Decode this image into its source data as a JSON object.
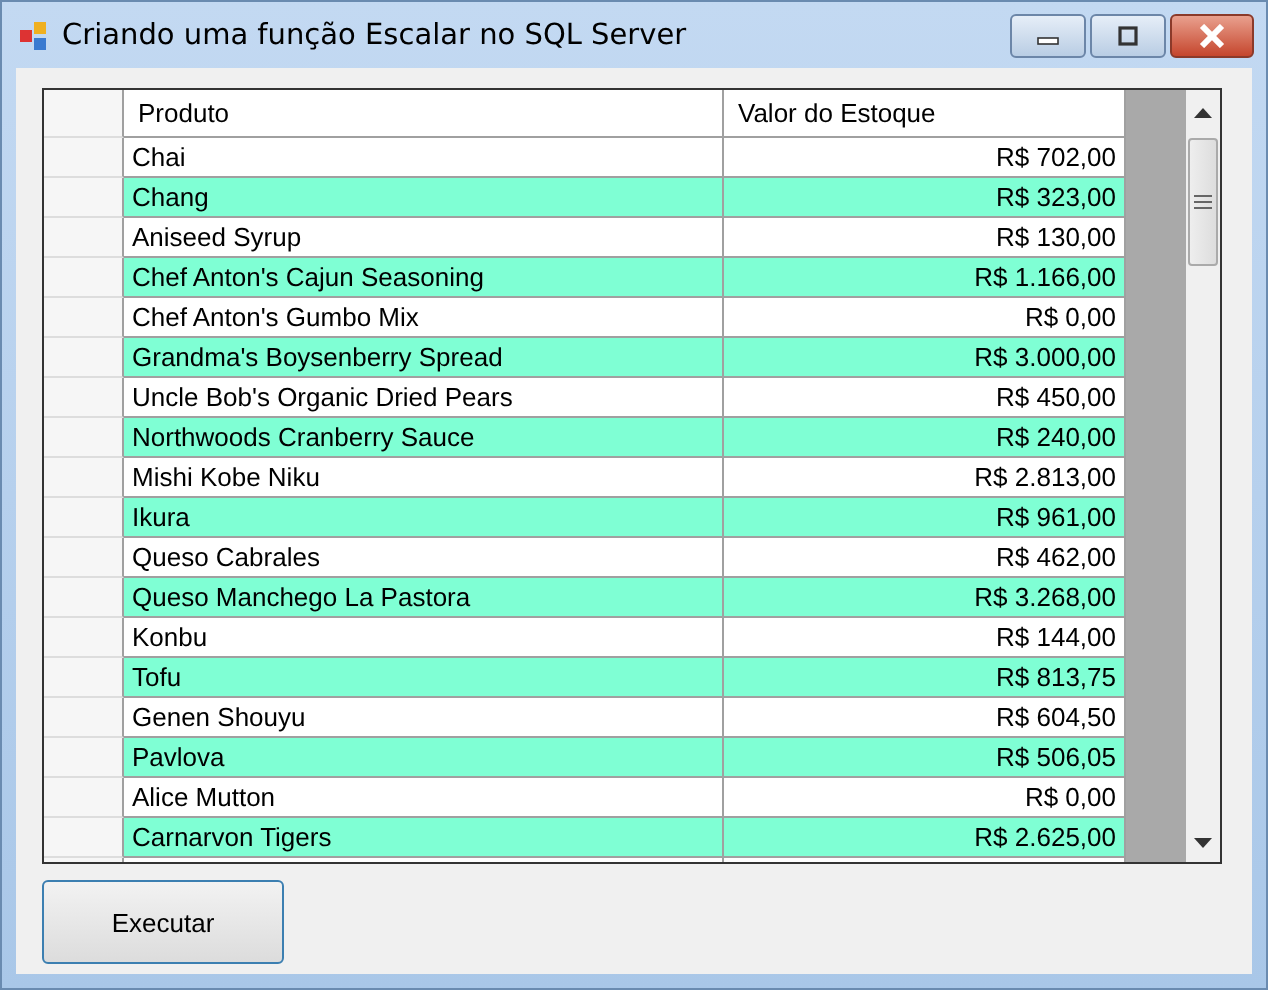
{
  "window": {
    "title": "Criando uma função Escalar no SQL Server"
  },
  "table": {
    "columns": [
      "Produto",
      "Valor do Estoque"
    ],
    "rows": [
      {
        "cells": [
          "Chai",
          "R$ 702,00"
        ],
        "color": "#ffffff"
      },
      {
        "cells": [
          "Chang",
          "R$ 323,00"
        ],
        "color": "#7fffd4"
      },
      {
        "cells": [
          "Aniseed Syrup",
          "R$ 130,00"
        ],
        "color": "#ffffff"
      },
      {
        "cells": [
          "Chef Anton's Cajun Seasoning",
          "R$ 1.166,00"
        ],
        "color": "#7fffd4"
      },
      {
        "cells": [
          "Chef Anton's Gumbo Mix",
          "R$ 0,00"
        ],
        "color": "#ffffff"
      },
      {
        "cells": [
          "Grandma's Boysenberry Spread",
          "R$ 3.000,00"
        ],
        "color": "#7fffd4"
      },
      {
        "cells": [
          "Uncle Bob's Organic Dried Pears",
          "R$ 450,00"
        ],
        "color": "#ffffff"
      },
      {
        "cells": [
          "Northwoods Cranberry Sauce",
          "R$ 240,00"
        ],
        "color": "#7fffd4"
      },
      {
        "cells": [
          "Mishi Kobe Niku",
          "R$ 2.813,00"
        ],
        "color": "#ffffff"
      },
      {
        "cells": [
          "Ikura",
          "R$ 961,00"
        ],
        "color": "#7fffd4"
      },
      {
        "cells": [
          "Queso Cabrales",
          "R$ 462,00"
        ],
        "color": "#ffffff"
      },
      {
        "cells": [
          "Queso Manchego La Pastora",
          "R$ 3.268,00"
        ],
        "color": "#7fffd4"
      },
      {
        "cells": [
          "Konbu",
          "R$ 144,00"
        ],
        "color": "#ffffff"
      },
      {
        "cells": [
          "Tofu",
          "R$ 813,75"
        ],
        "color": "#7fffd4"
      },
      {
        "cells": [
          "Genen Shouyu",
          "R$ 604,50"
        ],
        "color": "#ffffff"
      },
      {
        "cells": [
          "Pavlova",
          "R$ 506,05"
        ],
        "color": "#7fffd4"
      },
      {
        "cells": [
          "Alice Mutton",
          "R$ 0,00"
        ],
        "color": "#ffffff"
      },
      {
        "cells": [
          "Carnarvon Tigers",
          "R$ 2.625,00"
        ],
        "color": "#7fffd4"
      }
    ]
  },
  "buttons": [
    "Executar"
  ]
}
